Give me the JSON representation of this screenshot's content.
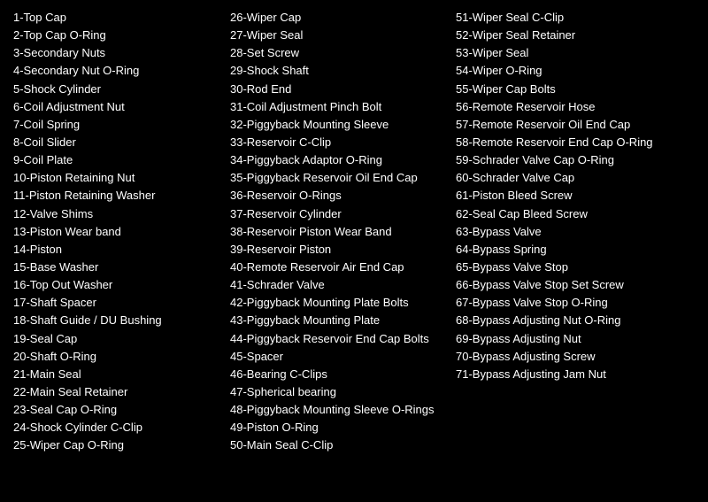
{
  "columns": [
    {
      "id": "col1",
      "items": [
        "1-Top Cap",
        "2-Top Cap O-Ring",
        "3-Secondary Nuts",
        "4-Secondary Nut O-Ring",
        "5-Shock Cylinder",
        "6-Coil Adjustment Nut",
        "7-Coil Spring",
        "8-Coil Slider",
        "9-Coil Plate",
        "10-Piston Retaining Nut",
        "11-Piston Retaining Washer",
        "12-Valve Shims",
        "13-Piston Wear band",
        "14-Piston",
        "15-Base Washer",
        "16-Top Out Washer",
        "17-Shaft Spacer",
        "18-Shaft Guide / DU Bushing",
        "19-Seal Cap",
        "20-Shaft O-Ring",
        "21-Main Seal",
        "22-Main Seal Retainer",
        "23-Seal Cap O-Ring",
        "24-Shock Cylinder C-Clip",
        "25-Wiper Cap O-Ring"
      ]
    },
    {
      "id": "col2",
      "items": [
        "26-Wiper Cap",
        "27-Wiper Seal",
        "28-Set Screw",
        "29-Shock Shaft",
        "30-Rod End",
        "31-Coil Adjustment Pinch Bolt",
        "32-Piggyback Mounting Sleeve",
        "33-Reservoir C-Clip",
        "34-Piggyback Adaptor O-Ring",
        "35-Piggyback Reservoir Oil End Cap",
        "36-Reservoir O-Rings",
        "37-Reservoir Cylinder",
        "38-Reservoir Piston Wear Band",
        "39-Reservoir Piston",
        "40-Remote Reservoir Air End Cap",
        "41-Schrader Valve",
        "42-Piggyback Mounting Plate Bolts",
        "43-Piggyback Mounting Plate",
        "44-Piggyback Reservoir End Cap Bolts",
        "45-Spacer",
        "46-Bearing C-Clips",
        "47-Spherical bearing",
        "48-Piggyback Mounting Sleeve O-Rings",
        "49-Piston O-Ring",
        "50-Main Seal C-Clip"
      ]
    },
    {
      "id": "col3",
      "items": [
        "51-Wiper Seal C-Clip",
        "52-Wiper Seal Retainer",
        "53-Wiper Seal",
        "54-Wiper O-Ring",
        "55-Wiper Cap Bolts",
        "56-Remote Reservoir Hose",
        "57-Remote Reservoir Oil End Cap",
        "58-Remote Reservoir End Cap O-Ring",
        "59-Schrader Valve Cap O-Ring",
        "60-Schrader Valve Cap",
        "61-Piston Bleed Screw",
        "62-Seal Cap Bleed Screw",
        "63-Bypass Valve",
        "64-Bypass Spring",
        "65-Bypass Valve Stop",
        "66-Bypass Valve Stop Set Screw",
        "67-Bypass Valve Stop O-Ring",
        "68-Bypass Adjusting Nut O-Ring",
        "69-Bypass Adjusting Nut",
        "70-Bypass Adjusting Screw",
        "71-Bypass Adjusting Jam Nut"
      ]
    }
  ]
}
